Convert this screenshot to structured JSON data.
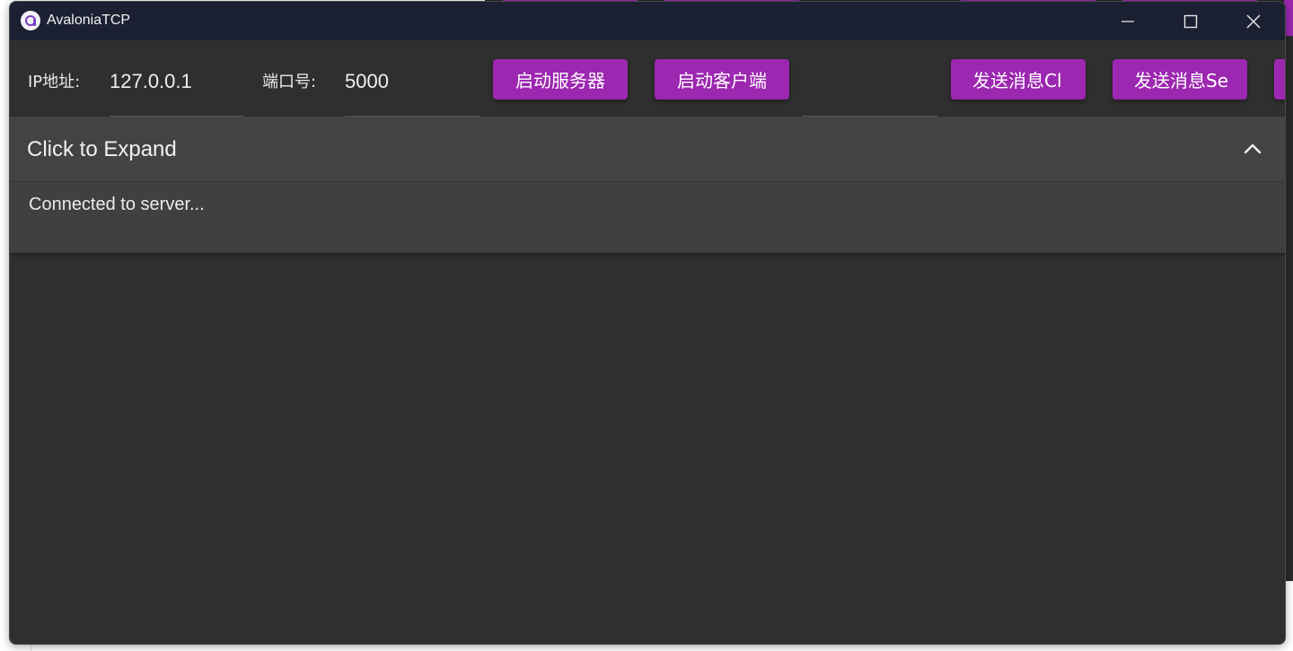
{
  "window": {
    "title": "AvaloniaTCP",
    "icon": "avalonia-logo-icon"
  },
  "toolbar": {
    "ip_label": "IP地址:",
    "ip_value": "127.0.0.1",
    "port_label": "端口号:",
    "port_value": "5000",
    "extra_value": "",
    "start_server": "启动服务器",
    "start_client": "启动客户端",
    "send_client": "发送消息Cl",
    "send_server": "发送消息Se"
  },
  "expander": {
    "header": "Click to Expand",
    "content": "Connected to server..."
  },
  "colors": {
    "accent": "#9c27b0",
    "titlebar": "#1c2033",
    "background": "#2f2f2f",
    "panel": "#404040"
  }
}
